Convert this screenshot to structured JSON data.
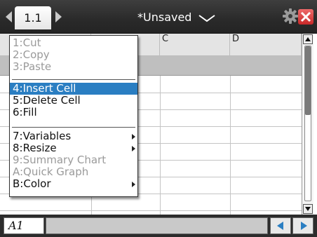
{
  "titlebar": {
    "tab_label": "1.1",
    "document_title": "*Unsaved",
    "icons": [
      "tab-prev-icon",
      "tab-next-icon",
      "chevron-down-icon",
      "gear-icon",
      "close-icon"
    ]
  },
  "sheet": {
    "columns": [
      "C",
      "D"
    ]
  },
  "context_menu": {
    "items": [
      {
        "label": "1:Cut",
        "enabled": false,
        "submenu": false
      },
      {
        "label": "2:Copy",
        "enabled": false,
        "submenu": false
      },
      {
        "label": "3:Paste",
        "enabled": false,
        "submenu": false
      },
      {
        "label": "4:Insert Cell",
        "enabled": true,
        "selected": true,
        "submenu": false
      },
      {
        "label": "5:Delete Cell",
        "enabled": true,
        "submenu": false
      },
      {
        "label": "6:Fill",
        "enabled": true,
        "submenu": false
      },
      {
        "label": "7:Variables",
        "enabled": true,
        "submenu": true
      },
      {
        "label": "8:Resize",
        "enabled": true,
        "submenu": true
      },
      {
        "label": "9:Summary Chart",
        "enabled": false,
        "submenu": false
      },
      {
        "label": "A:Quick Graph",
        "enabled": false,
        "submenu": false
      },
      {
        "label": "B:Color",
        "enabled": true,
        "submenu": true
      }
    ]
  },
  "statusbar": {
    "cell_reference": "A1",
    "entry_value": ""
  },
  "colors": {
    "selection": "#2a7ec2",
    "titlebar": "#2a2a2a",
    "close": "#d83a3a",
    "disabled_text": "#9a9a9a"
  }
}
